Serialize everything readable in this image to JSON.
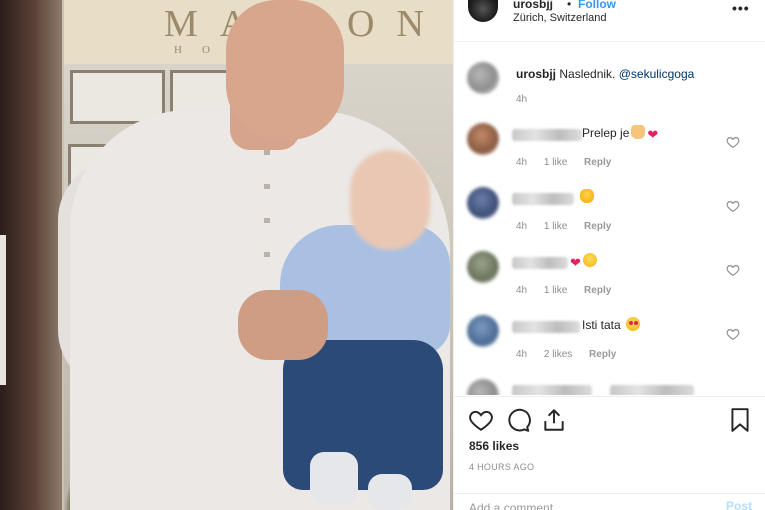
{
  "post": {
    "username": "urosbjj",
    "separator": "•",
    "follow_label": "Follow",
    "location": "Zürich, Switzerland",
    "more_label": "•••"
  },
  "photo": {
    "sign_text": "MAISON",
    "sign_sub": "HOTEL"
  },
  "caption": {
    "username": "urosbjj",
    "text": "Naslednik.",
    "mention": "@sekulicgoga",
    "time": "4h"
  },
  "comments": [
    {
      "text": "Prelep je",
      "emojis": [
        "folded-hands-emoji",
        "red-heart-emoji"
      ],
      "time": "4h",
      "likes": "1 like",
      "reply": "Reply"
    },
    {
      "text": "",
      "emojis": [
        "screaming-face-emoji"
      ],
      "time": "4h",
      "likes": "1 like",
      "reply": "Reply"
    },
    {
      "text": "",
      "emojis": [
        "red-heart-emoji",
        "smiling-face-emoji"
      ],
      "time": "4h",
      "likes": "1 like",
      "reply": "Reply"
    },
    {
      "text": "Isti tata",
      "emojis": [
        "heart-eyes-emoji"
      ],
      "time": "4h",
      "likes": "2 likes",
      "reply": "Reply"
    }
  ],
  "actions": {
    "likes": "856 likes",
    "time_ago": "4 HOURS AGO",
    "add_comment_placeholder": "Add a comment...",
    "post_label": "Post"
  },
  "colors": {
    "accent": "#3897f0",
    "heart": "#e0245e",
    "text": "#262626",
    "muted": "#8e8e8e"
  }
}
